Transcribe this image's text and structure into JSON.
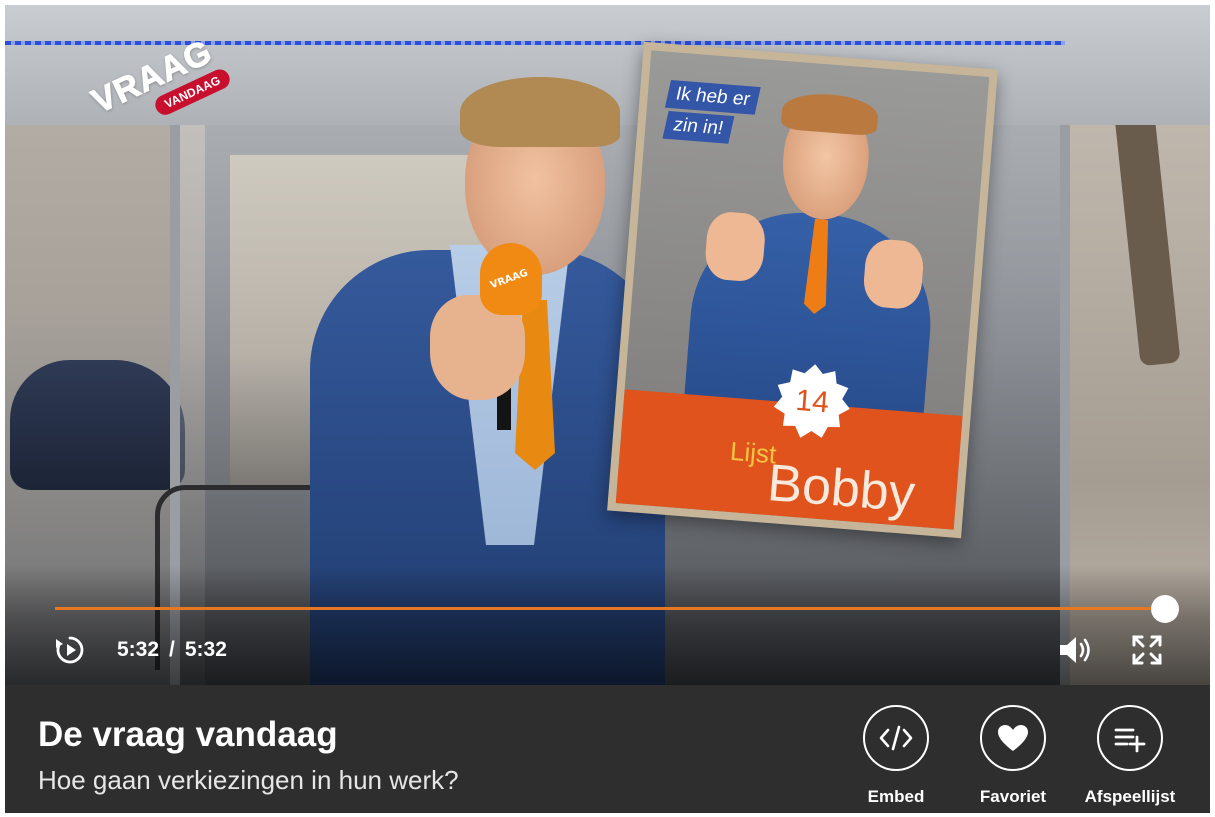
{
  "channel": {
    "logo_word": "VRAAG",
    "logo_tag": "VANDAAG"
  },
  "video": {
    "poster": {
      "slogan_line1": "Ik heb er",
      "slogan_line2": "zin in!",
      "number": "14",
      "list_label": "Lijst",
      "name": "Bobby"
    },
    "mic_brand": "VRAAG"
  },
  "player": {
    "current_time": "5:32",
    "separator": "/",
    "duration": "5:32",
    "progress_fraction": 1.0,
    "accent_color": "#e87722",
    "icons": {
      "replay": "replay-icon",
      "volume": "volume-icon",
      "fullscreen": "fullscreen-icon"
    }
  },
  "info": {
    "title": "De vraag vandaag",
    "subtitle": "Hoe gaan verkiezingen in hun werk?",
    "actions": [
      {
        "label": "Embed",
        "icon": "code-icon"
      },
      {
        "label": "Favoriet",
        "icon": "heart-icon"
      },
      {
        "label": "Afspeellijst",
        "icon": "playlist-add-icon"
      }
    ]
  }
}
